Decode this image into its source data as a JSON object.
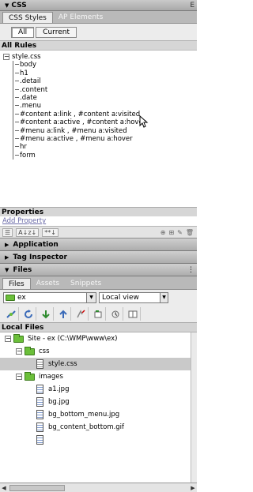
{
  "css_panel": {
    "title": "CSS",
    "title_tail": "E",
    "tabs": [
      "CSS Styles",
      "AP Elements"
    ],
    "mode_buttons": [
      "All",
      "Current"
    ],
    "rules_heading": "All Rules",
    "stylesheet": "style.css",
    "rules": [
      "body",
      "h1",
      ".detail",
      ".content",
      ".date",
      ".menu",
      "#content a:link , #content a:visited",
      "#content a:active , #content a:hover",
      "#menu a:link , #menu a:visited",
      "#menu a:active , #menu a:hover",
      "hr",
      "form"
    ],
    "properties_heading": "Properties",
    "add_property": "Add Property",
    "toolbar": {
      "az_label": "A↓z↓",
      "star_label": "**↓"
    }
  },
  "collapsed_panels": [
    "Application",
    "Tag Inspector"
  ],
  "files_panel": {
    "title": "Files",
    "tabs": [
      "Files",
      "Assets",
      "Snippets"
    ],
    "site_value": "ex",
    "view_value": "Local view",
    "local_heading": "Local Files",
    "tree": [
      {
        "indent": 0,
        "expand": "−",
        "kind": "folder",
        "label": "Site - ex (C:\\WMP\\www\\ex)"
      },
      {
        "indent": 1,
        "expand": "−",
        "kind": "folder",
        "label": "css"
      },
      {
        "indent": 2,
        "expand": "",
        "kind": "css",
        "label": "style.css",
        "selected": true
      },
      {
        "indent": 1,
        "expand": "−",
        "kind": "folder",
        "label": "images"
      },
      {
        "indent": 2,
        "expand": "",
        "kind": "img",
        "label": "a1.jpg"
      },
      {
        "indent": 2,
        "expand": "",
        "kind": "img",
        "label": "bg.jpg"
      },
      {
        "indent": 2,
        "expand": "",
        "kind": "img",
        "label": "bg_bottom_menu.jpg"
      },
      {
        "indent": 2,
        "expand": "",
        "kind": "img",
        "label": "bg_content_bottom.gif"
      },
      {
        "indent": 2,
        "expand": "",
        "kind": "img",
        "label": ""
      }
    ]
  },
  "colors": {
    "folder_green": "#6bbf3a",
    "link_blue": "#6a6aa8",
    "selection_gray": "#c9c9c9"
  }
}
